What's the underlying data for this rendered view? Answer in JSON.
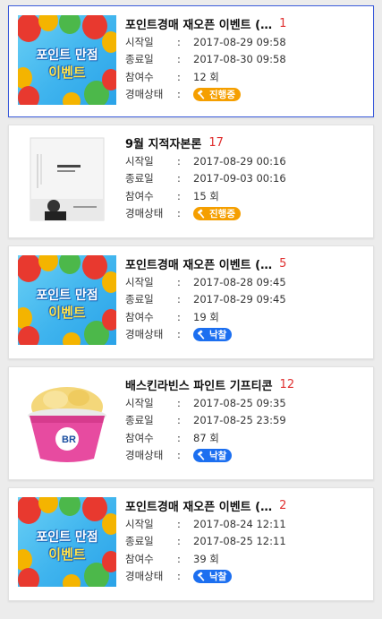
{
  "labels": {
    "start": "시작일",
    "end": "종료일",
    "participants": "참여수",
    "status": "경매상태",
    "colon": ":"
  },
  "items": [
    {
      "title": "포인트경매 재오픈 이벤트 (…",
      "count": "1",
      "start": "2017-08-29 09:58",
      "end": "2017-08-30 09:58",
      "participants": "12 회",
      "status": "진행중",
      "thumb_text_1": "포인트 만점",
      "thumb_text_2": "이벤트"
    },
    {
      "title": "9월 지적자본론",
      "count": "17",
      "start": "2017-08-29 00:16",
      "end": "2017-09-03 00:16",
      "participants": "15 회",
      "status": "진행중"
    },
    {
      "title": "포인트경매 재오픈 이벤트 (…",
      "count": "5",
      "start": "2017-08-28 09:45",
      "end": "2017-08-29 09:45",
      "participants": "19 회",
      "status": "낙찰",
      "thumb_text_1": "포인트 만점",
      "thumb_text_2": "이벤트"
    },
    {
      "title": "배스킨라빈스 파인트 기프티콘",
      "count": "12",
      "start": "2017-08-25 09:35",
      "end": "2017-08-25 23:59",
      "participants": "87 회",
      "status": "낙찰"
    },
    {
      "title": "포인트경매 재오픈 이벤트 (…",
      "count": "2",
      "start": "2017-08-24 12:11",
      "end": "2017-08-25 12:11",
      "participants": "39 회",
      "status": "낙찰",
      "thumb_text_1": "포인트 만점",
      "thumb_text_2": "이벤트"
    }
  ],
  "colors": {
    "progress_badge": "#f59f00",
    "won_badge": "#1c6ff0",
    "count": "#e03131",
    "selected_border": "#3b5bdb"
  }
}
